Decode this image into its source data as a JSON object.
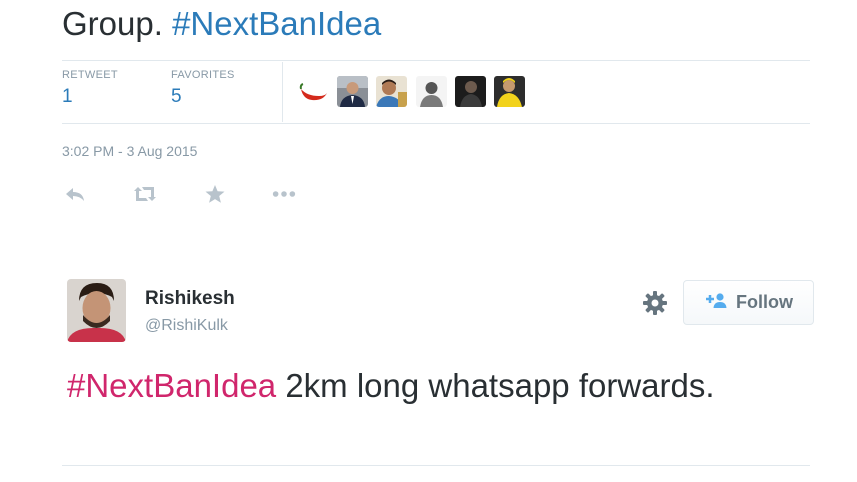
{
  "tweet1": {
    "text_prefix": "Group.",
    "hashtag": "#NextBanIdea",
    "stats": {
      "retweet_label": "RETWEET",
      "retweet_count": "1",
      "favorites_label": "FAVORITES",
      "favorites_count": "5"
    },
    "favoriter_avatar_count": 6,
    "timestamp": "3:02 PM - 3 Aug 2015",
    "actions": [
      "reply-icon",
      "retweet-icon",
      "favorite-icon",
      "more-icon"
    ]
  },
  "tweet2": {
    "display_name": "Rishikesh",
    "handle": "@RishiKulk",
    "follow_label": "Follow",
    "hashtag": "#NextBanIdea",
    "text_rest": "2km long whatsapp forwards."
  },
  "colors": {
    "text": "#292f33",
    "muted": "#8899a6",
    "link_blue": "#2b7bb9",
    "hashtag_pink": "#d0266c",
    "divider": "#e1e8ed"
  }
}
